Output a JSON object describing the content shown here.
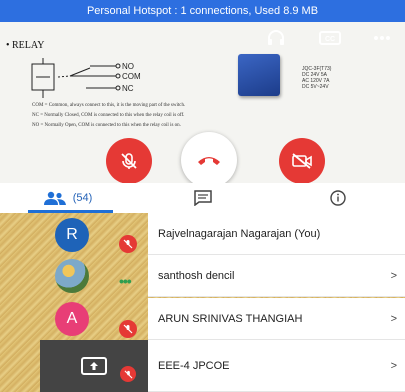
{
  "status_bar": {
    "text": "Personal Hotspot : 1 connections, Used 8.9 MB",
    "color": "#2d6fe0"
  },
  "video": {
    "slide": {
      "title": "• RELAY",
      "schematic": {
        "no": "NO",
        "com": "COM",
        "nc": "NC"
      },
      "spec_lines": [
        "JQC-3F(T73)",
        "DC 24V 5A",
        "AC 120V 7A",
        "DC 5V~24V"
      ],
      "bullets": [
        "COM = Common, always connect to this, it is the moving part of the switch.",
        "NC = Normally Closed, COM is connected to this when the relay coil is off.",
        "NO = Normally Open, COM is connected to this when the relay coil is on."
      ]
    },
    "controls": {
      "top": [
        "headphones-icon",
        "cc-icon",
        "more-icon"
      ],
      "bottom": [
        "mic-off-icon",
        "end-call-icon",
        "video-off-icon"
      ]
    }
  },
  "tabs": {
    "participants_count": "(54)",
    "items": [
      "participants-tab",
      "chat-tab",
      "info-tab"
    ]
  },
  "participants": [
    {
      "initial": "R",
      "name": "Rajvelnagarajan Nagarajan (You)",
      "avatar_color": "#1e63b8",
      "badge": "mic-off",
      "chevron": ""
    },
    {
      "initial": "",
      "name": "santhosh dencil",
      "avatar_color": "#3f7fae",
      "badge": "more-dots",
      "chevron": ">"
    },
    {
      "initial": "A",
      "name": "ARUN SRINIVAS THANGIAH",
      "avatar_color": "#e83e76",
      "badge": "mic-off",
      "chevron": ">"
    },
    {
      "initial": "",
      "name": "EEE-4 JPCOE",
      "avatar_color": "#444444",
      "badge": "mic-off",
      "chevron": ">"
    }
  ],
  "colors": {
    "accent": "#1f6fd6",
    "danger": "#e53935",
    "avatar_green_dots": "#2e9e4f"
  }
}
